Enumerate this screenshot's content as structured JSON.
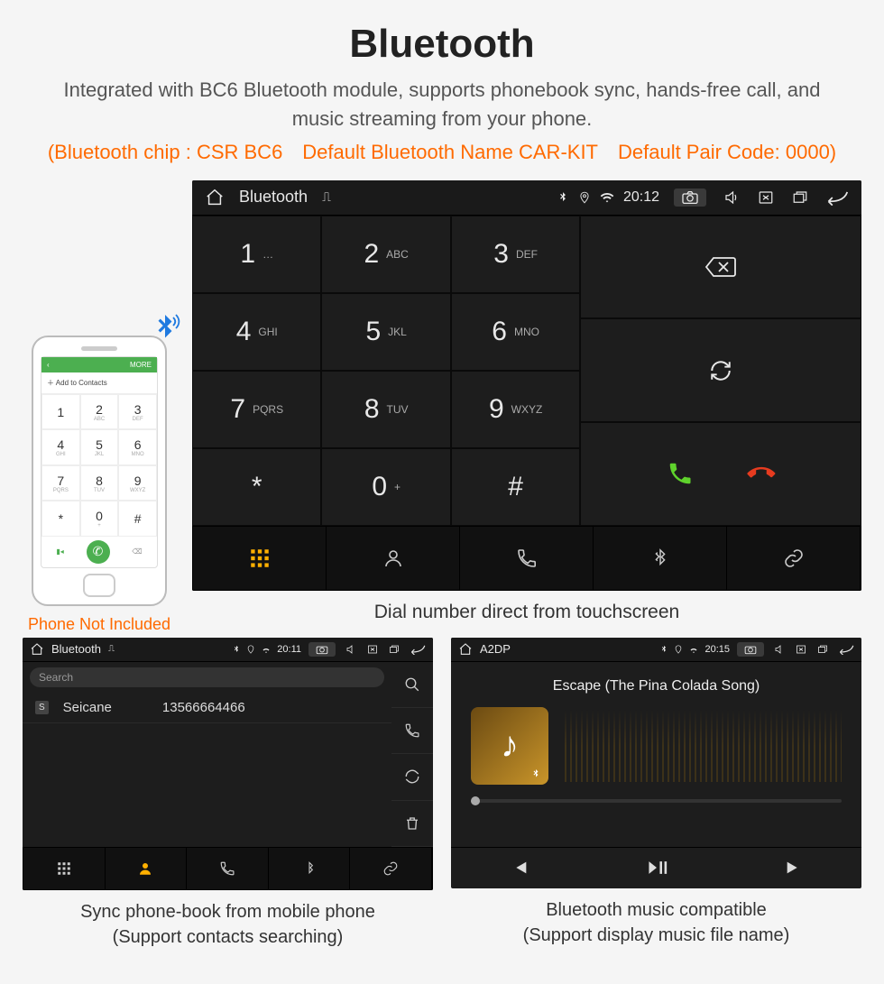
{
  "header": {
    "title": "Bluetooth",
    "subtitle": "Integrated with BC6 Bluetooth module, supports phonebook sync, hands-free call, and music streaming from your phone.",
    "spec": "(Bluetooth chip : CSR BC6 Default Bluetooth Name CAR-KIT Default Pair Code: 0000)"
  },
  "phone": {
    "caption": "Phone Not Included",
    "top_more": "MORE",
    "add_label": "Add to Contacts",
    "keys": [
      {
        "d": "1",
        "l": ""
      },
      {
        "d": "2",
        "l": "ABC"
      },
      {
        "d": "3",
        "l": "DEF"
      },
      {
        "d": "4",
        "l": "GHI"
      },
      {
        "d": "5",
        "l": "JKL"
      },
      {
        "d": "6",
        "l": "MNO"
      },
      {
        "d": "7",
        "l": "PQRS"
      },
      {
        "d": "8",
        "l": "TUV"
      },
      {
        "d": "9",
        "l": "WXYZ"
      },
      {
        "d": "*",
        "l": ""
      },
      {
        "d": "0",
        "l": "+"
      },
      {
        "d": "#",
        "l": ""
      }
    ]
  },
  "dialer": {
    "status": {
      "title": "Bluetooth",
      "time": "20:12"
    },
    "keys": [
      {
        "d": "1",
        "l": "…"
      },
      {
        "d": "2",
        "l": "ABC"
      },
      {
        "d": "3",
        "l": "DEF"
      },
      {
        "d": "4",
        "l": "GHI"
      },
      {
        "d": "5",
        "l": "JKL"
      },
      {
        "d": "6",
        "l": "MNO"
      },
      {
        "d": "7",
        "l": "PQRS"
      },
      {
        "d": "8",
        "l": "TUV"
      },
      {
        "d": "9",
        "l": "WXYZ"
      },
      {
        "d": "*",
        "l": ""
      },
      {
        "d": "0",
        "l": "+"
      },
      {
        "d": "#",
        "l": ""
      }
    ],
    "caption": "Dial number direct from touchscreen"
  },
  "phonebook": {
    "status": {
      "title": "Bluetooth",
      "time": "20:11"
    },
    "search_placeholder": "Search",
    "contact": {
      "tag": "S",
      "name": "Seicane",
      "number": "13566664466"
    },
    "caption_l1": "Sync phone-book from mobile phone",
    "caption_l2": "(Support contacts searching)"
  },
  "music": {
    "status": {
      "title": "A2DP",
      "time": "20:15"
    },
    "track": "Escape (The Pina Colada Song)",
    "caption_l1": "Bluetooth music compatible",
    "caption_l2": "(Support display music file name)"
  }
}
